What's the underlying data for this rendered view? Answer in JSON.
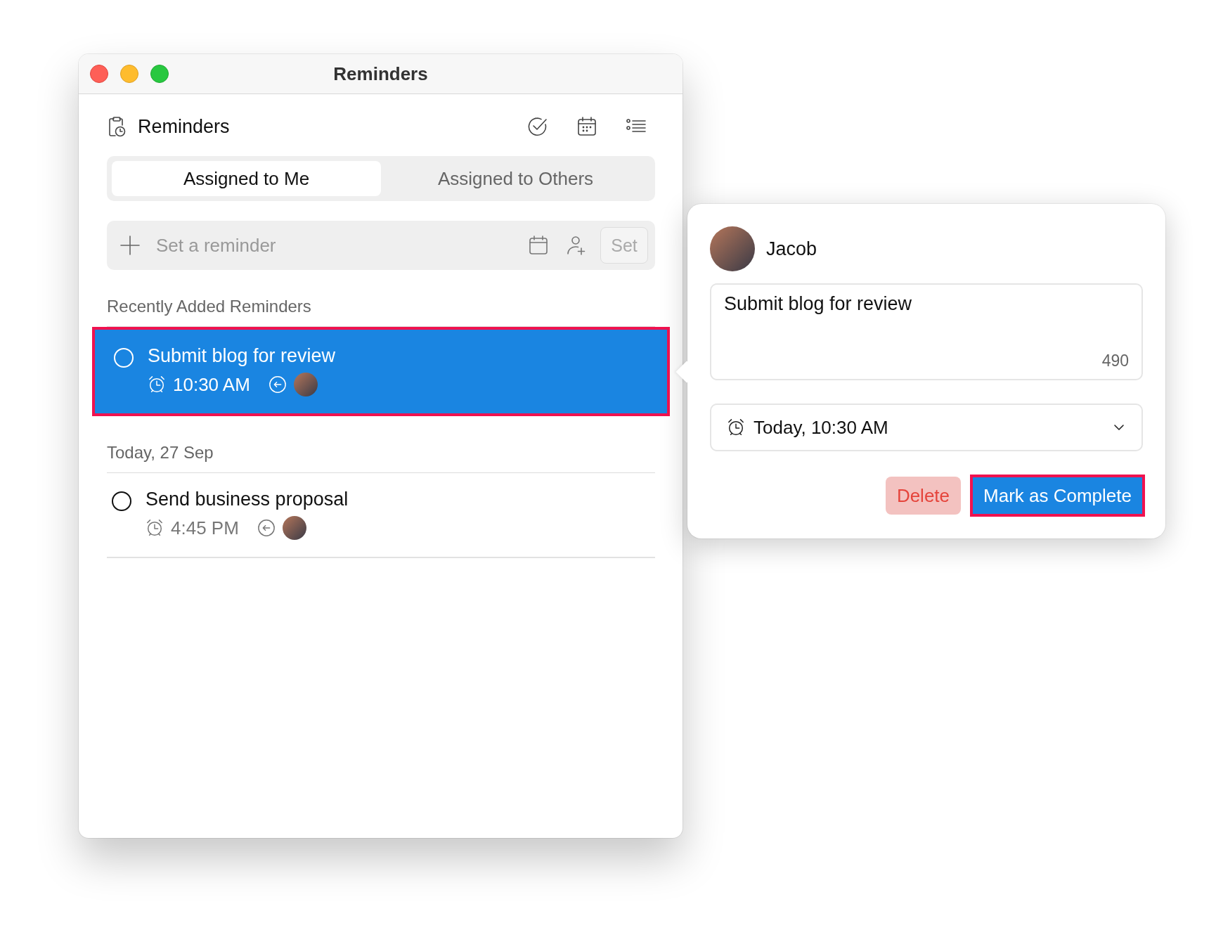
{
  "window": {
    "title": "Reminders"
  },
  "header": {
    "title": "Reminders"
  },
  "tabs": [
    {
      "label": "Assigned to Me",
      "selected": true
    },
    {
      "label": "Assigned to Others",
      "selected": false
    }
  ],
  "new_reminder": {
    "placeholder": "Set a reminder",
    "button": "Set",
    "button_disabled": true
  },
  "sections": [
    {
      "heading": "Recently Added Reminders",
      "reminders": [
        {
          "title": "Submit blog for review",
          "time": "10:30 AM",
          "selected": true,
          "highlighted": true,
          "completed": false
        }
      ]
    },
    {
      "heading": "Today, 27 Sep",
      "reminders": [
        {
          "title": "Send business proposal",
          "time": "4:45 PM",
          "selected": false,
          "highlighted": false,
          "completed": false
        }
      ]
    }
  ],
  "detail": {
    "assignee": "Jacob",
    "note": "Submit blog for review",
    "char_count": "490",
    "due": "Today, 10:30 AM",
    "buttons": [
      {
        "label": "Delete",
        "kind": "destructive",
        "highlighted": false
      },
      {
        "label": "Mark as Complete",
        "kind": "primary",
        "highlighted": true
      }
    ]
  }
}
